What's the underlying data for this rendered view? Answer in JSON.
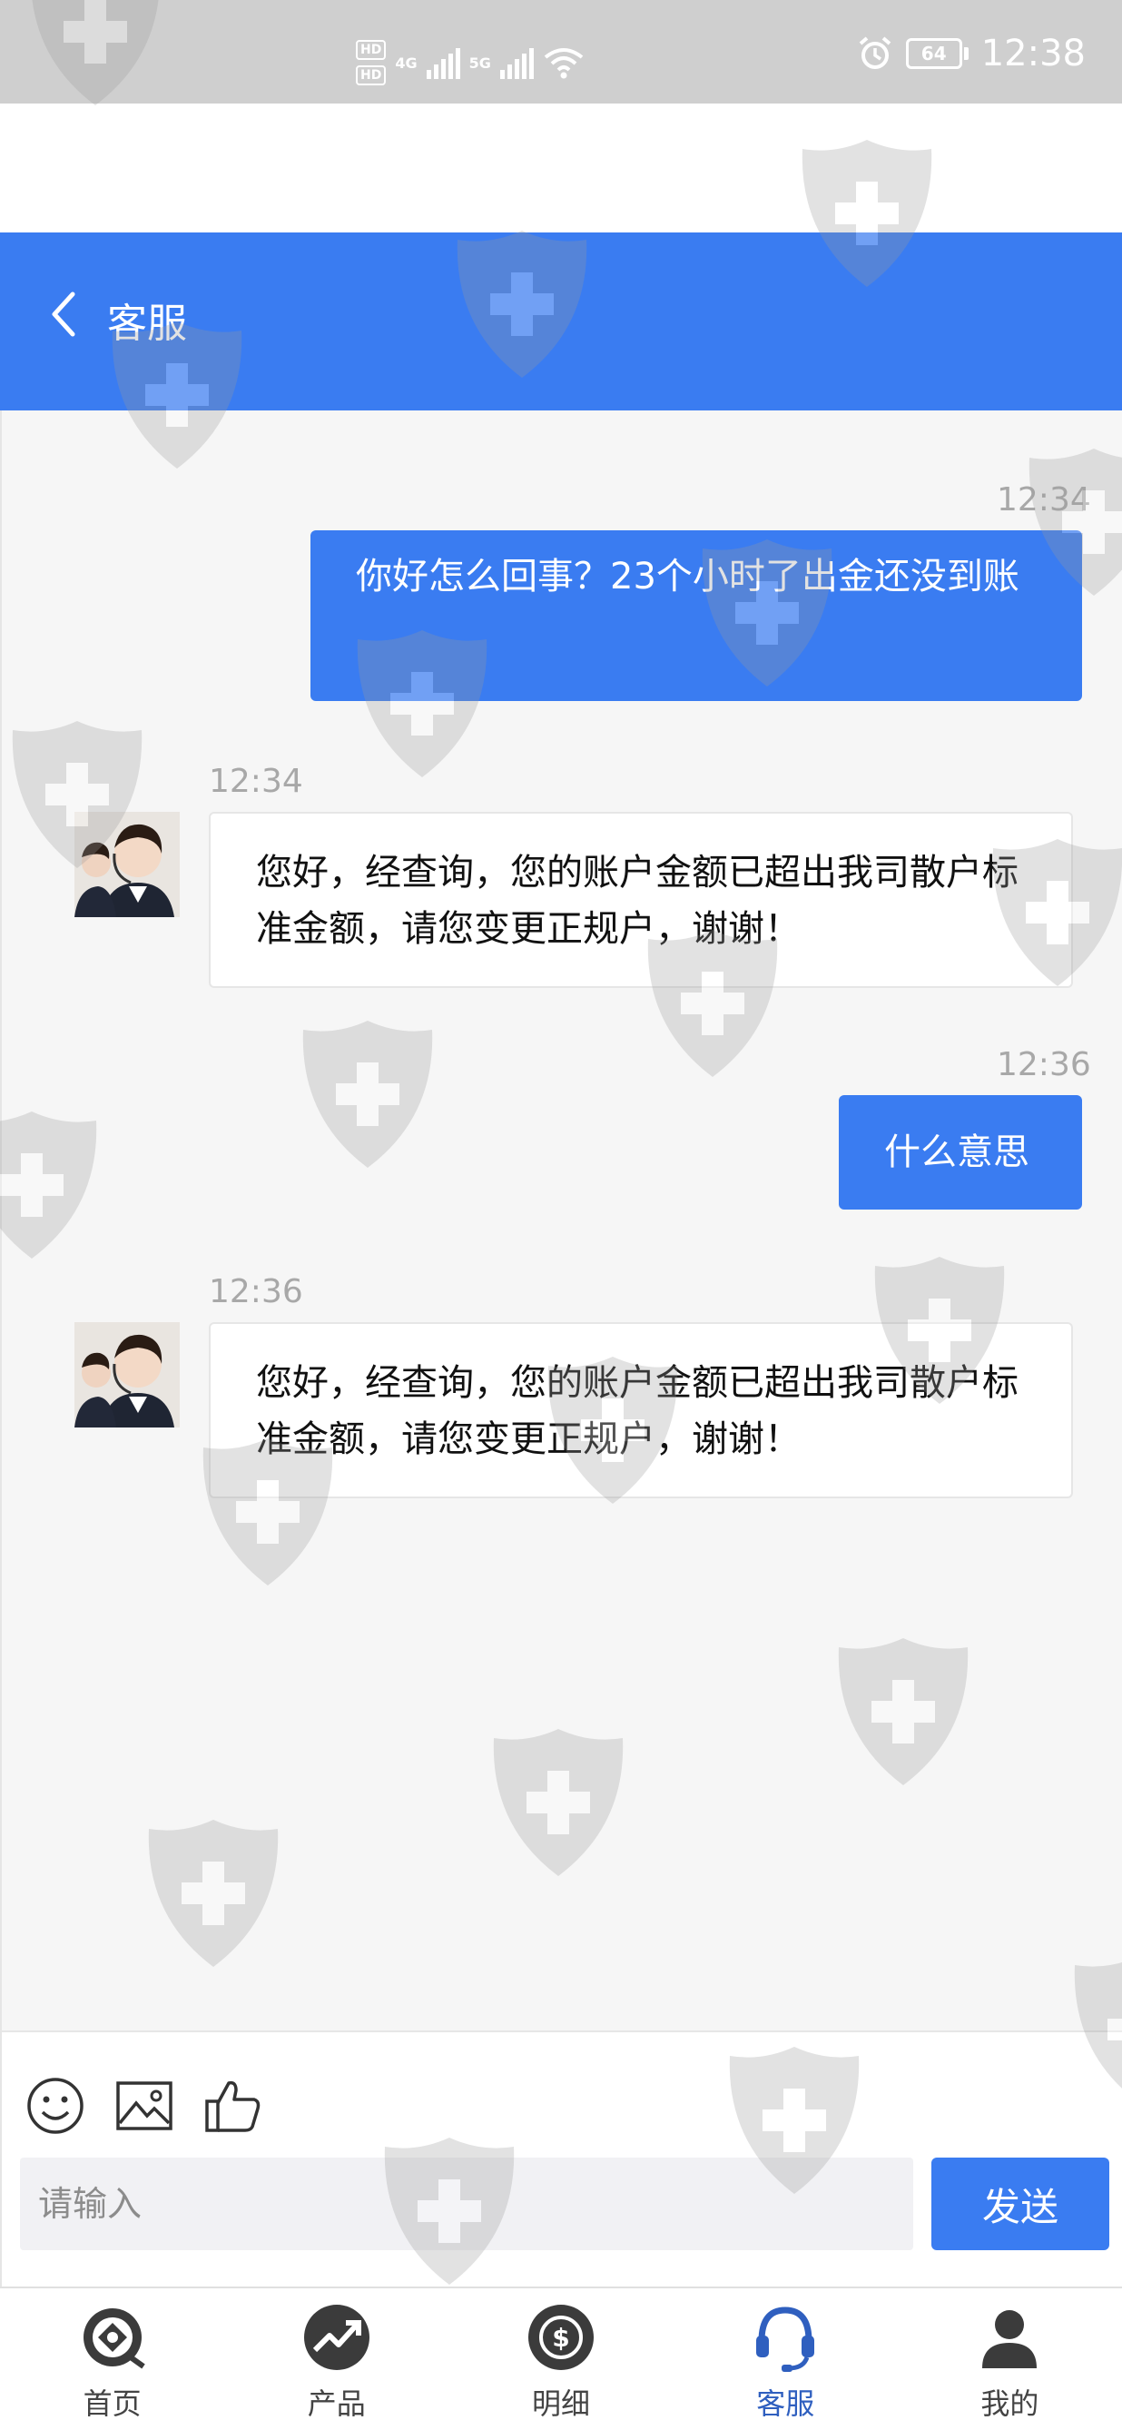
{
  "status_bar": {
    "hd1": "HD",
    "hd2": "HD",
    "net1": "4G",
    "net2": "5G",
    "battery": "64",
    "time": "12:38"
  },
  "header": {
    "title": "客服"
  },
  "messages": [
    {
      "time": "12:34",
      "side": "out",
      "text": "你好怎么回事？23个小时了出金还没到账"
    },
    {
      "time": "12:34",
      "side": "in",
      "text": "您好，经查询，您的账户金额已超出我司散户标准金额，请您变更正规户，谢谢！"
    },
    {
      "time": "12:36",
      "side": "out",
      "text": "什么意思"
    },
    {
      "time": "12:36",
      "side": "in",
      "text": "您好，经查询，您的账户金额已超出我司散户标准金额，请您变更正规户，谢谢！"
    }
  ],
  "composer": {
    "placeholder": "请输入",
    "send_label": "发送",
    "tools": [
      "emoji-icon",
      "image-icon",
      "thumbs-up-icon"
    ]
  },
  "bottom_nav": [
    {
      "label": "首页",
      "icon": "home-target-icon",
      "active": false
    },
    {
      "label": "产品",
      "icon": "trend-chart-icon",
      "active": false
    },
    {
      "label": "明细",
      "icon": "dollar-cycle-icon",
      "active": false
    },
    {
      "label": "客服",
      "icon": "headset-icon",
      "active": true
    },
    {
      "label": "我的",
      "icon": "user-icon",
      "active": false
    }
  ],
  "colors": {
    "primary": "#3a7cf1",
    "chat_bg": "#f6f6f6",
    "timestamp": "#a8a8a8"
  }
}
